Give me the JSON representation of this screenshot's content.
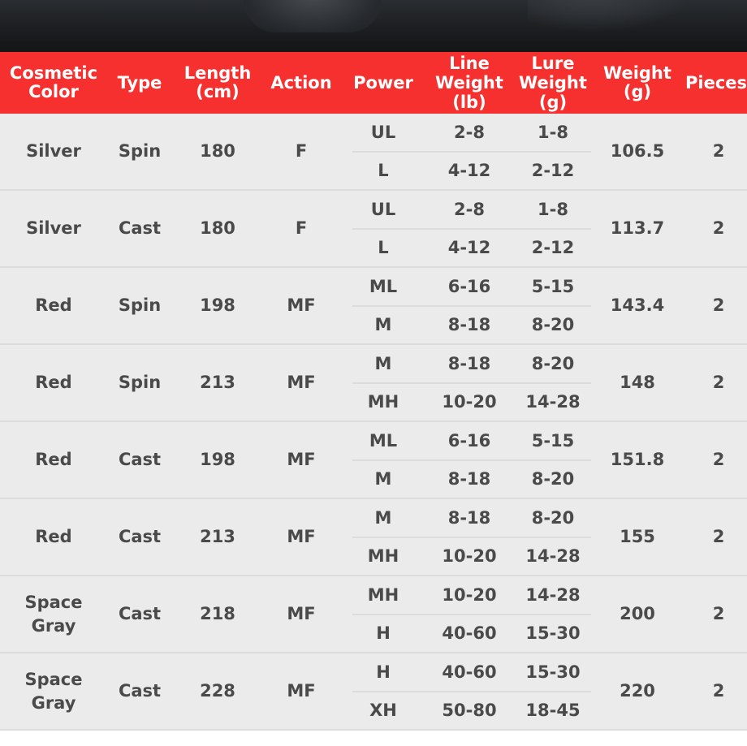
{
  "table": {
    "headers": [
      "Cosmetic\nColor",
      "Type",
      "Length\n(cm)",
      "Action",
      "Power",
      "Line\nWeight\n(lb)",
      "Lure\nWeight\n(g)",
      "Weight\n(g)",
      "Pieces"
    ],
    "rows": [
      {
        "color": "Silver",
        "type": "Spin",
        "length": "180",
        "action": "F",
        "power": [
          "UL",
          "L"
        ],
        "line_weight": [
          "2-8",
          "4-12"
        ],
        "lure_weight": [
          "1-8",
          "2-12"
        ],
        "weight": "106.5",
        "pieces": "2"
      },
      {
        "color": "Silver",
        "type": "Cast",
        "length": "180",
        "action": "F",
        "power": [
          "UL",
          "L"
        ],
        "line_weight": [
          "2-8",
          "4-12"
        ],
        "lure_weight": [
          "1-8",
          "2-12"
        ],
        "weight": "113.7",
        "pieces": "2"
      },
      {
        "color": "Red",
        "type": "Spin",
        "length": "198",
        "action": "MF",
        "power": [
          "ML",
          "M"
        ],
        "line_weight": [
          "6-16",
          "8-18"
        ],
        "lure_weight": [
          "5-15",
          "8-20"
        ],
        "weight": "143.4",
        "pieces": "2"
      },
      {
        "color": "Red",
        "type": "Spin",
        "length": "213",
        "action": "MF",
        "power": [
          "M",
          "MH"
        ],
        "line_weight": [
          "8-18",
          "10-20"
        ],
        "lure_weight": [
          "8-20",
          "14-28"
        ],
        "weight": "148",
        "pieces": "2"
      },
      {
        "color": "Red",
        "type": "Cast",
        "length": "198",
        "action": "MF",
        "power": [
          "ML",
          "M"
        ],
        "line_weight": [
          "6-16",
          "8-18"
        ],
        "lure_weight": [
          "5-15",
          "8-20"
        ],
        "weight": "151.8",
        "pieces": "2"
      },
      {
        "color": "Red",
        "type": "Cast",
        "length": "213",
        "action": "MF",
        "power": [
          "M",
          "MH"
        ],
        "line_weight": [
          "8-18",
          "10-20"
        ],
        "lure_weight": [
          "8-20",
          "14-28"
        ],
        "weight": "155",
        "pieces": "2"
      },
      {
        "color": "Space\nGray",
        "type": "Cast",
        "length": "218",
        "action": "MF",
        "power": [
          "MH",
          "H"
        ],
        "line_weight": [
          "10-20",
          "40-60"
        ],
        "lure_weight": [
          "14-28",
          "15-30"
        ],
        "weight": "200",
        "pieces": "2"
      },
      {
        "color": "Space\nGray",
        "type": "Cast",
        "length": "228",
        "action": "MF",
        "power": [
          "H",
          "XH"
        ],
        "line_weight": [
          "40-60",
          "50-80"
        ],
        "lure_weight": [
          "15-30",
          "18-45"
        ],
        "weight": "220",
        "pieces": "2"
      }
    ]
  },
  "colors": {
    "header_bg": "#f5302e",
    "row_bg": "#ebebeb",
    "text": "#4a4a4a"
  }
}
